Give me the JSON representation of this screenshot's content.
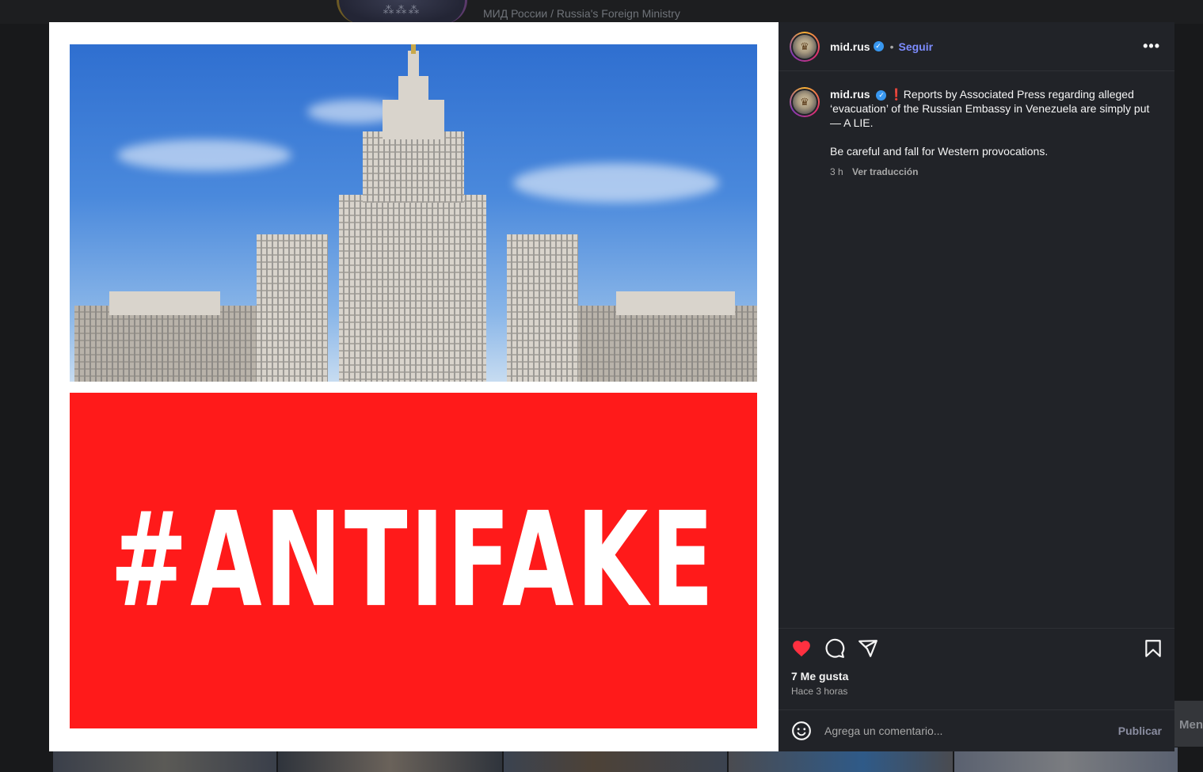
{
  "background": {
    "page_title": "МИД России / Russia's Foreign Ministry",
    "side_button_label": "Men"
  },
  "media": {
    "banner_text": "#ANTIFAKE",
    "banner_color": "#ff1a1a"
  },
  "post": {
    "username": "mid.rus",
    "verified": true,
    "follow_label": "Seguir",
    "more_label": "•••",
    "caption_prefix": "❗",
    "caption_text": "Reports by Associated Press regarding alleged ‘evacuation’ of the Russian Embassy in Venezuela are simply put — A LIE.",
    "caption_text_2": "Be careful and fall for Western provocations.",
    "time_short": "3 h",
    "translate_label": "Ver traducción",
    "likes_label": "7 Me gusta",
    "time_long": "Hace 3 horas",
    "liked": true
  },
  "comment": {
    "placeholder": "Agrega un comentario...",
    "publish_label": "Publicar"
  },
  "colors": {
    "accent_link": "#7d8cff",
    "like_red": "#ff3040",
    "panel_bg": "#212328"
  }
}
